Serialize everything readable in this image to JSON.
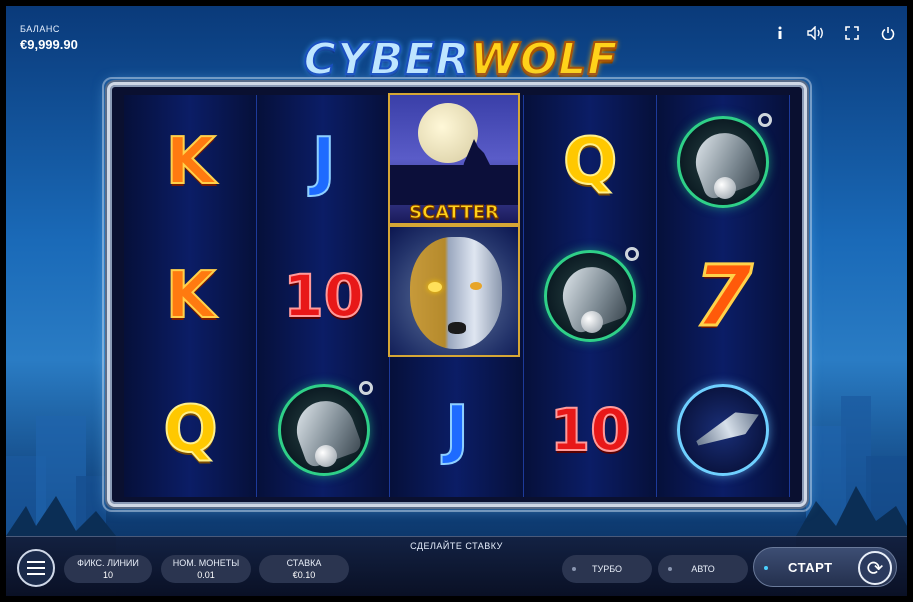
{
  "balance": {
    "label": "БАЛАНС",
    "value": "€9,999.90"
  },
  "logo": {
    "part1": "CYBER",
    "part2": "WOLF"
  },
  "top_icons": [
    "info-icon",
    "sound-icon",
    "fullscreen-icon",
    "power-icon"
  ],
  "reels": [
    [
      "K",
      "K",
      "Q"
    ],
    [
      "J",
      "10",
      "bell"
    ],
    [
      "scatter",
      "wolf",
      "J"
    ],
    [
      "Q",
      "bell",
      "10"
    ],
    [
      "bell",
      "7",
      "spaceship"
    ]
  ],
  "scatter_label": "SCATTER",
  "bottom": {
    "prompt": "СДЕЛАЙТЕ СТАВКУ",
    "lines_label": "ФИКС. ЛИНИИ",
    "lines_value": "10",
    "coin_label": "НОМ. МОНЕТЫ",
    "coin_value": "0.01",
    "bet_label": "СТАВКА",
    "bet_value": "€0.10",
    "turbo_label": "ТУРБО",
    "auto_label": "АВТО",
    "start_label": "СТАРТ"
  }
}
